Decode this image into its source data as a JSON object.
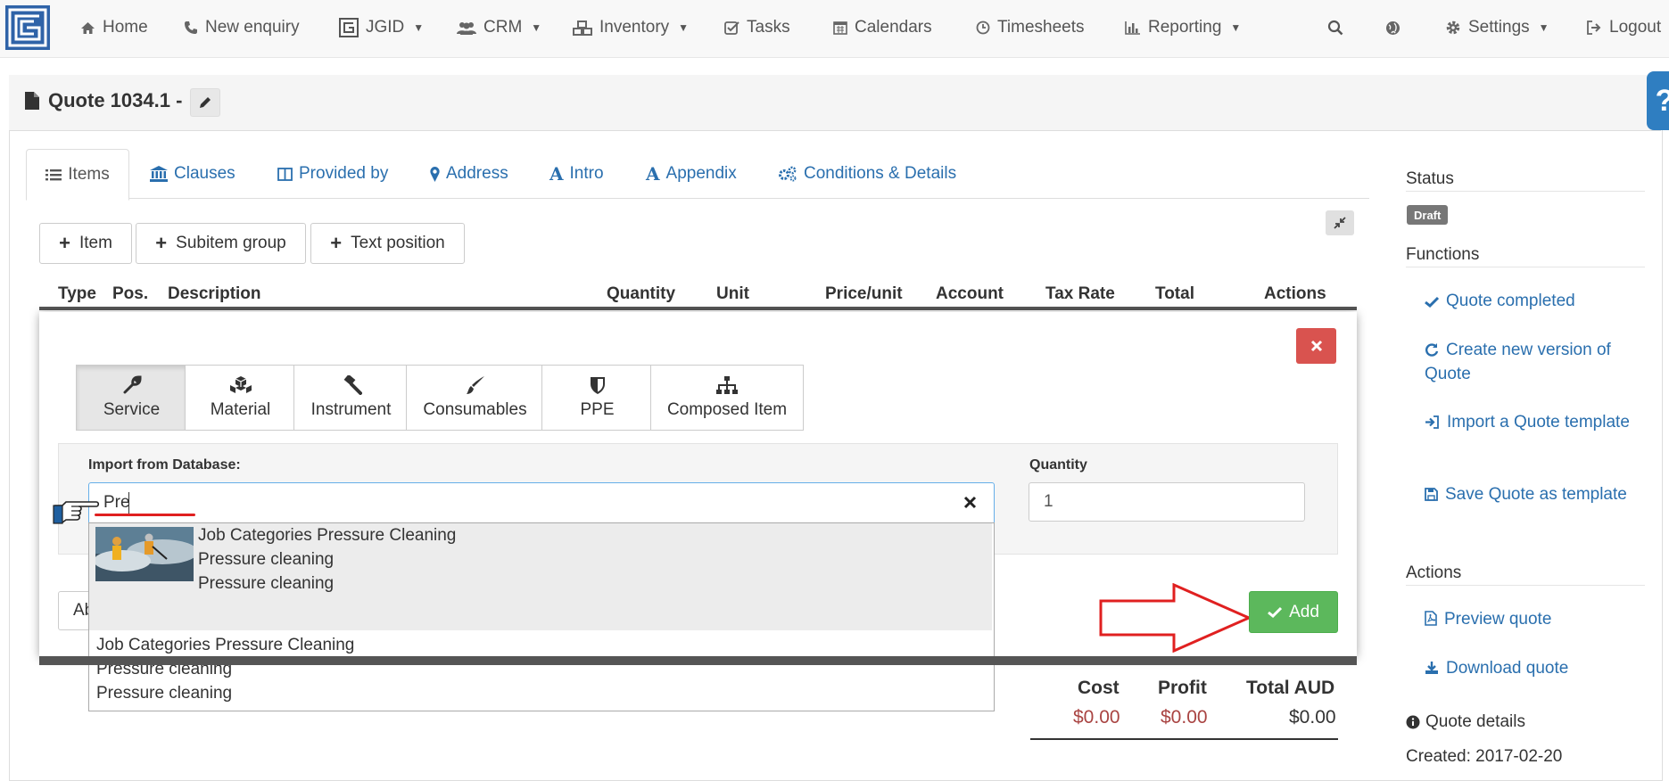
{
  "nav": {
    "items": [
      {
        "label": "Home",
        "icon": "home-icon"
      },
      {
        "label": "New enquiry",
        "icon": "phone-icon"
      },
      {
        "label": "JGID",
        "icon": "jgid-icon",
        "dropdown": true
      },
      {
        "label": "CRM",
        "icon": "users-icon",
        "dropdown": true
      },
      {
        "label": "Inventory",
        "icon": "cubes-icon",
        "dropdown": true
      },
      {
        "label": "Tasks",
        "icon": "check-square-icon"
      },
      {
        "label": "Calendars",
        "icon": "calendar-icon"
      },
      {
        "label": "Timesheets",
        "icon": "clock-icon"
      },
      {
        "label": "Reporting",
        "icon": "bar-chart-icon",
        "dropdown": true
      },
      {
        "label": "Settings",
        "icon": "gear-icon",
        "dropdown": true
      },
      {
        "label": "Logout",
        "icon": "sign-out-icon"
      }
    ]
  },
  "quote": {
    "title": "Quote 1034.1 -"
  },
  "help": {
    "label": "?"
  },
  "tabs": [
    {
      "label": "Items",
      "icon": "list-icon",
      "active": true
    },
    {
      "label": "Clauses",
      "icon": "bank-icon"
    },
    {
      "label": "Provided by",
      "icon": "columns-icon"
    },
    {
      "label": "Address",
      "icon": "map-marker-icon"
    },
    {
      "label": "Intro",
      "icon": "font-icon"
    },
    {
      "label": "Appendix",
      "icon": "font-icon"
    },
    {
      "label": "Conditions & Details",
      "icon": "gears-icon"
    }
  ],
  "toolbar": {
    "item": "Item",
    "subitem_group": "Subitem group",
    "text_position": "Text position"
  },
  "table": {
    "headers": [
      "Type",
      "Pos.",
      "Description",
      "Quantity",
      "Unit",
      "Price/unit",
      "Account",
      "Tax Rate",
      "Total",
      "Actions"
    ]
  },
  "modal": {
    "types": [
      {
        "label": "Service",
        "icon": "wrench-icon",
        "active": true
      },
      {
        "label": "Material",
        "icon": "cubes-icon"
      },
      {
        "label": "Instrument",
        "icon": "gavel-icon"
      },
      {
        "label": "Consumables",
        "icon": "paint-brush-icon"
      },
      {
        "label": "PPE",
        "icon": "shield-icon"
      },
      {
        "label": "Composed Item",
        "icon": "sitemap-icon"
      }
    ],
    "import_label": "Import from Database:",
    "search_value": "Pre",
    "quantity_label": "Quantity",
    "quantity_value": "1",
    "results": [
      {
        "line1": "Job Categories Pressure Cleaning",
        "line2": "Pressure cleaning",
        "line3": "Pressure cleaning",
        "has_image": true,
        "highlighted": true
      },
      {
        "line1": "Job Categories Pressure Cleaning",
        "line2": "Pressure cleaning",
        "line3": "Pressure cleaning",
        "has_image": false
      }
    ],
    "abort_label": "Abort",
    "add_label": "Add"
  },
  "summary": {
    "cost_label": "Cost",
    "profit_label": "Profit",
    "total_label": "Total AUD",
    "cost_value": "$0.00",
    "profit_value": "$0.00",
    "total_value": "$0.00"
  },
  "sidebar": {
    "status_heading": "Status",
    "status_badge": "Draft",
    "functions_heading": "Functions",
    "functions": [
      {
        "label": "Quote completed",
        "icon": "check-icon"
      },
      {
        "label": "Create new version of Quote",
        "icon": "refresh-icon"
      },
      {
        "label": "Import a Quote template",
        "icon": "sign-in-icon"
      },
      {
        "label": "Save Quote as template",
        "icon": "floppy-icon"
      }
    ],
    "actions_heading": "Actions",
    "actions": [
      {
        "label": "Preview quote",
        "icon": "file-pdf-icon"
      },
      {
        "label": "Download quote",
        "icon": "download-icon"
      }
    ],
    "details_heading": "Quote details",
    "created": "Created: 2017-02-20"
  },
  "colors": {
    "link": "#2a6fae",
    "danger": "#d9534f",
    "success": "#5cb85c",
    "negative": "#a94442",
    "help": "#2f7ec1",
    "annotation": "#e02020"
  }
}
